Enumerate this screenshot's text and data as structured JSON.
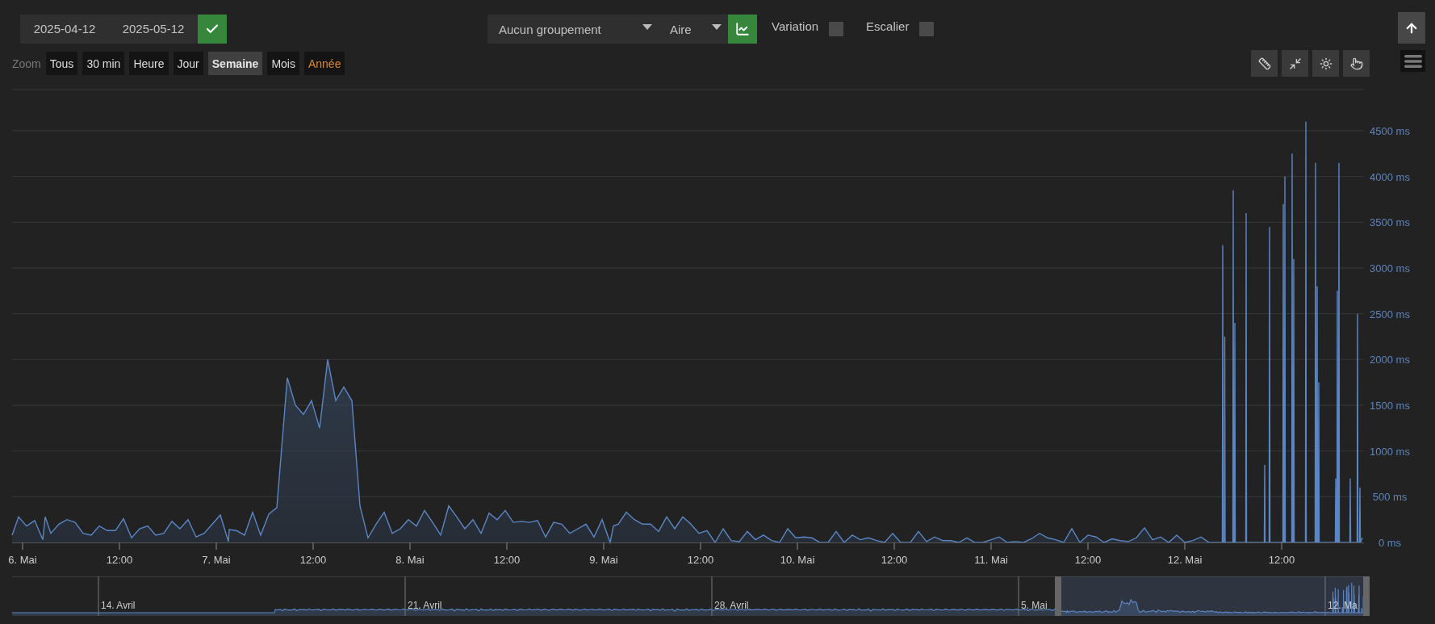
{
  "date_range": {
    "start": "2025-04-12",
    "end": "2025-05-12"
  },
  "grouping": {
    "value": "Aucun groupement"
  },
  "chart_type": {
    "value": "Aire"
  },
  "options": [
    {
      "label": "Variation",
      "checked": false
    },
    {
      "label": "Escalier",
      "checked": false
    }
  ],
  "zoom": {
    "label": "Zoom",
    "buttons": [
      {
        "label": "Tous",
        "selected": false,
        "highlighted": false
      },
      {
        "label": "30 min",
        "selected": false,
        "highlighted": false
      },
      {
        "label": "Heure",
        "selected": false,
        "highlighted": false
      },
      {
        "label": "Jour",
        "selected": false,
        "highlighted": false
      },
      {
        "label": "Semaine",
        "selected": true,
        "highlighted": false
      },
      {
        "label": "Mois",
        "selected": false,
        "highlighted": false
      },
      {
        "label": "Année",
        "selected": false,
        "highlighted": true
      }
    ]
  },
  "chart": {
    "chart_data": {
      "type": "area",
      "grid": true,
      "xlim": [
        "2025-05-05 22:42",
        "2025-05-12 22:12"
      ],
      "ylim": [
        0,
        4950
      ],
      "x": [
        "2025-05-05 22:42",
        "2025-05-05 23:30",
        "2025-05-06 00:30",
        "2025-05-06 01:30",
        "2025-05-06 02:30",
        "2025-05-06 02:48",
        "2025-05-06 03:30",
        "2025-05-06 04:30",
        "2025-05-06 05:30",
        "2025-05-06 06:30",
        "2025-05-06 07:30",
        "2025-05-06 08:30",
        "2025-05-06 09:30",
        "2025-05-06 10:30",
        "2025-05-06 11:30",
        "2025-05-06 12:30",
        "2025-05-06 13:30",
        "2025-05-06 14:30",
        "2025-05-06 15:30",
        "2025-05-06 16:30",
        "2025-05-06 17:30",
        "2025-05-06 18:30",
        "2025-05-06 19:30",
        "2025-05-06 20:30",
        "2025-05-06 21:30",
        "2025-05-06 22:30",
        "2025-05-06 23:30",
        "2025-05-07 00:30",
        "2025-05-07 01:30",
        "2025-05-07 01:36",
        "2025-05-07 02:30",
        "2025-05-07 03:30",
        "2025-05-07 04:30",
        "2025-05-07 05:30",
        "2025-05-07 06:30",
        "2025-05-07 07:30",
        "2025-05-07 08:48",
        "2025-05-07 09:48",
        "2025-05-07 10:48",
        "2025-05-07 11:48",
        "2025-05-07 12:48",
        "2025-05-07 13:48",
        "2025-05-07 14:48",
        "2025-05-07 15:48",
        "2025-05-07 16:48",
        "2025-05-07 17:48",
        "2025-05-07 18:48",
        "2025-05-07 19:48",
        "2025-05-07 20:48",
        "2025-05-07 21:48",
        "2025-05-07 22:48",
        "2025-05-07 23:48",
        "2025-05-08 00:48",
        "2025-05-08 01:48",
        "2025-05-08 02:48",
        "2025-05-08 03:48",
        "2025-05-08 04:48",
        "2025-05-08 05:48",
        "2025-05-08 06:48",
        "2025-05-08 07:48",
        "2025-05-08 08:48",
        "2025-05-08 09:48",
        "2025-05-08 10:48",
        "2025-05-08 11:48",
        "2025-05-08 12:48",
        "2025-05-08 13:48",
        "2025-05-08 14:48",
        "2025-05-08 15:48",
        "2025-05-08 16:48",
        "2025-05-08 17:48",
        "2025-05-08 18:48",
        "2025-05-08 19:48",
        "2025-05-08 20:48",
        "2025-05-08 21:48",
        "2025-05-08 22:48",
        "2025-05-08 23:48",
        "2025-05-09 00:48",
        "2025-05-09 01:12",
        "2025-05-09 01:48",
        "2025-05-09 02:48",
        "2025-05-09 03:48",
        "2025-05-09 04:48",
        "2025-05-09 05:48",
        "2025-05-09 06:48",
        "2025-05-09 07:48",
        "2025-05-09 08:48",
        "2025-05-09 09:48",
        "2025-05-09 10:48",
        "2025-05-09 11:48",
        "2025-05-09 12:48",
        "2025-05-09 13:48",
        "2025-05-09 14:48",
        "2025-05-09 15:48",
        "2025-05-09 16:48",
        "2025-05-09 17:48",
        "2025-05-09 18:48",
        "2025-05-09 19:48",
        "2025-05-09 20:48",
        "2025-05-09 21:48",
        "2025-05-09 22:48",
        "2025-05-09 23:48",
        "2025-05-10 00:48",
        "2025-05-10 01:48",
        "2025-05-10 02:48",
        "2025-05-10 03:48",
        "2025-05-10 04:48",
        "2025-05-10 05:48",
        "2025-05-10 06:48",
        "2025-05-10 07:48",
        "2025-05-10 08:48",
        "2025-05-10 09:48",
        "2025-05-10 10:48",
        "2025-05-10 11:48",
        "2025-05-10 12:48",
        "2025-05-10 14:00",
        "2025-05-10 15:00",
        "2025-05-10 16:00",
        "2025-05-10 17:00",
        "2025-05-10 18:00",
        "2025-05-10 19:00",
        "2025-05-10 20:00",
        "2025-05-10 21:00",
        "2025-05-10 22:00",
        "2025-05-10 23:00",
        "2025-05-11 00:00",
        "2025-05-11 01:00",
        "2025-05-11 02:00",
        "2025-05-11 03:00",
        "2025-05-11 04:00",
        "2025-05-11 05:00",
        "2025-05-11 06:00",
        "2025-05-11 07:00",
        "2025-05-11 08:00",
        "2025-05-11 09:00",
        "2025-05-11 10:00",
        "2025-05-11 11:00",
        "2025-05-11 12:00",
        "2025-05-11 13:00",
        "2025-05-11 14:00",
        "2025-05-11 15:00",
        "2025-05-11 16:00",
        "2025-05-11 17:00",
        "2025-05-11 18:00",
        "2025-05-11 19:00",
        "2025-05-11 20:00",
        "2025-05-11 21:00",
        "2025-05-11 22:00",
        "2025-05-11 23:00",
        "2025-05-12 00:00",
        "2025-05-12 01:00",
        "2025-05-12 02:00",
        "2025-05-12 03:00",
        "2025-05-12 04:00",
        "2025-05-12 04:39",
        "2025-05-12 04:42",
        "2025-05-12 04:45",
        "2025-05-12 04:54",
        "2025-05-12 04:57",
        "2025-05-12 05:00",
        "2025-05-12 05:57",
        "2025-05-12 06:00",
        "2025-05-12 06:03",
        "2025-05-12 06:09",
        "2025-05-12 06:12",
        "2025-05-12 06:15",
        "2025-05-12 07:33",
        "2025-05-12 07:36",
        "2025-05-12 07:39",
        "2025-05-12 09:51",
        "2025-05-12 09:54",
        "2025-05-12 09:57",
        "2025-05-12 10:27",
        "2025-05-12 10:30",
        "2025-05-12 10:33",
        "2025-05-12 12:09",
        "2025-05-12 12:12",
        "2025-05-12 12:15",
        "2025-05-12 12:21",
        "2025-05-12 12:24",
        "2025-05-12 12:27",
        "2025-05-12 13:15",
        "2025-05-12 13:18",
        "2025-05-12 13:21",
        "2025-05-12 13:27",
        "2025-05-12 13:30",
        "2025-05-12 13:33",
        "2025-05-12 14:57",
        "2025-05-12 15:00",
        "2025-05-12 15:03",
        "2025-05-12 16:09",
        "2025-05-12 16:12",
        "2025-05-12 16:15",
        "2025-05-12 16:21",
        "2025-05-12 16:24",
        "2025-05-12 16:27",
        "2025-05-12 16:33",
        "2025-05-12 16:36",
        "2025-05-12 16:39",
        "2025-05-12 18:39",
        "2025-05-12 18:42",
        "2025-05-12 18:45",
        "2025-05-12 18:51",
        "2025-05-12 18:54",
        "2025-05-12 18:57",
        "2025-05-12 19:03",
        "2025-05-12 19:06",
        "2025-05-12 19:09",
        "2025-05-12 20:27",
        "2025-05-12 20:30",
        "2025-05-12 20:33",
        "2025-05-12 21:21",
        "2025-05-12 21:24",
        "2025-05-12 21:27",
        "2025-05-12 21:39",
        "2025-05-12 21:42",
        "2025-05-12 21:45",
        "2025-05-12 22:00"
      ],
      "series": [
        {
          "color": "#5b86c5",
          "values": [
            80,
            280,
            180,
            240,
            30,
            280,
            100,
            200,
            250,
            220,
            100,
            80,
            180,
            130,
            130,
            260,
            50,
            150,
            180,
            80,
            100,
            230,
            150,
            250,
            60,
            100,
            200,
            300,
            10,
            140,
            130,
            80,
            330,
            80,
            310,
            380,
            1800,
            1500,
            1400,
            1550,
            1250,
            2000,
            1550,
            1700,
            1550,
            400,
            50,
            200,
            330,
            100,
            150,
            250,
            180,
            350,
            220,
            80,
            400,
            280,
            150,
            250,
            100,
            320,
            250,
            350,
            220,
            230,
            220,
            240,
            60,
            220,
            200,
            100,
            150,
            200,
            60,
            250,
            0,
            180,
            200,
            330,
            250,
            200,
            200,
            120,
            280,
            150,
            280,
            200,
            100,
            130,
            0,
            150,
            20,
            10,
            120,
            30,
            80,
            20,
            0,
            150,
            50,
            60,
            50,
            0,
            0,
            120,
            0,
            80,
            30,
            50,
            20,
            0,
            100,
            0,
            0,
            120,
            10,
            60,
            20,
            20,
            0,
            50,
            0,
            0,
            30,
            60,
            0,
            10,
            0,
            40,
            100,
            50,
            30,
            0,
            150,
            0,
            80,
            60,
            0,
            40,
            20,
            10,
            50,
            160,
            30,
            60,
            0,
            80,
            0,
            20,
            60,
            0,
            0,
            0,
            3250,
            0,
            0,
            2250,
            0,
            0,
            3850,
            0,
            0,
            2400,
            0,
            0,
            3600,
            0,
            0,
            850,
            0,
            0,
            3450,
            0,
            0,
            3700,
            0,
            0,
            4000,
            0,
            0,
            4250,
            0,
            0,
            3100,
            0,
            0,
            4600,
            0,
            0,
            4150,
            0,
            0,
            2800,
            0,
            0,
            1750,
            0,
            0,
            700,
            0,
            0,
            2750,
            0,
            0,
            4150,
            0,
            0,
            700,
            0,
            0,
            2500,
            0,
            0,
            600,
            0,
            50
          ]
        }
      ],
      "xticks": [
        {
          "value": "2025-05-06 00:00",
          "label": "6. Mai"
        },
        {
          "value": "2025-05-06 12:00",
          "label": "12:00"
        },
        {
          "value": "2025-05-07 00:00",
          "label": "7. Mai"
        },
        {
          "value": "2025-05-07 12:00",
          "label": "12:00"
        },
        {
          "value": "2025-05-08 00:00",
          "label": "8. Mai"
        },
        {
          "value": "2025-05-08 12:00",
          "label": "12:00"
        },
        {
          "value": "2025-05-09 00:00",
          "label": "9. Mai"
        },
        {
          "value": "2025-05-09 12:00",
          "label": "12:00"
        },
        {
          "value": "2025-05-10 00:00",
          "label": "10. Mai"
        },
        {
          "value": "2025-05-10 12:00",
          "label": "12:00"
        },
        {
          "value": "2025-05-11 00:00",
          "label": "11. Mai"
        },
        {
          "value": "2025-05-11 12:00",
          "label": "12:00"
        },
        {
          "value": "2025-05-12 00:00",
          "label": "12. Mai"
        },
        {
          "value": "2025-05-12 12:00",
          "label": "12:00"
        }
      ],
      "yticks": [
        {
          "value": 0,
          "label": "0 ms"
        },
        {
          "value": 500,
          "label": "500 ms"
        },
        {
          "value": 1000,
          "label": "1000 ms"
        },
        {
          "value": 1500,
          "label": "1500 ms"
        },
        {
          "value": 2000,
          "label": "2000 ms"
        },
        {
          "value": 2500,
          "label": "2500 ms"
        },
        {
          "value": 3000,
          "label": "3000 ms"
        },
        {
          "value": 3500,
          "label": "3500 ms"
        },
        {
          "value": 4000,
          "label": "4000 ms"
        },
        {
          "value": 4500,
          "label": "4500 ms"
        }
      ]
    }
  },
  "navigator": {
    "labels": [
      "14. Avril",
      "21. Avril",
      "28. Avril",
      "5. Mai",
      "12. Ma"
    ]
  }
}
